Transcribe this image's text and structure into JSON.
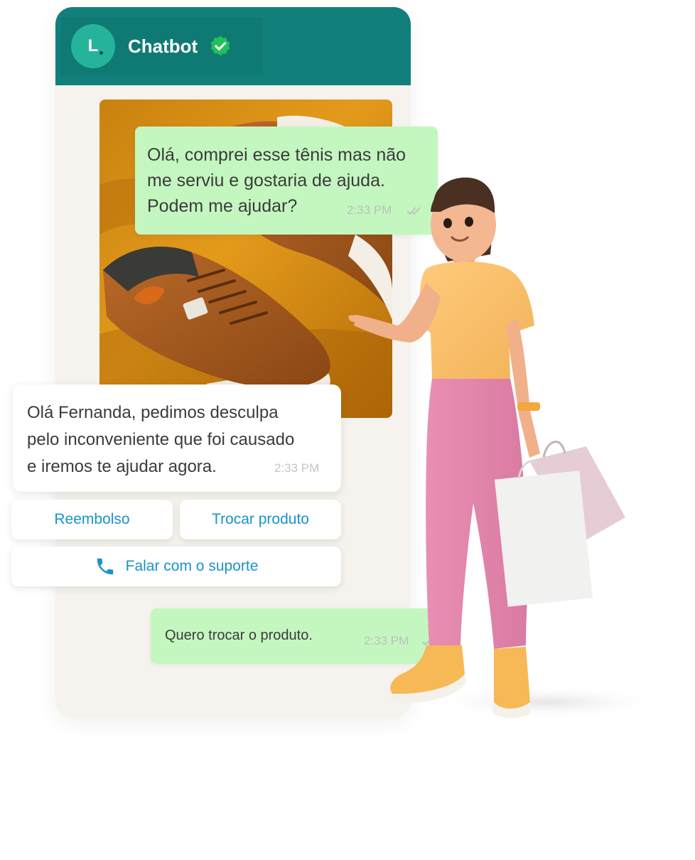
{
  "header": {
    "avatar_letter": "L",
    "title": "Chatbot",
    "verified_icon": "verified-check-icon"
  },
  "messages": {
    "customer_first": {
      "lines": [
        "Olá, comprei esse tênis mas não",
        "me serviu e gostaria de ajuda.",
        "Podem me ajudar?"
      ],
      "time": "2:33 PM"
    },
    "bot_reply": {
      "lines": [
        "Olá Fernanda, pedimos desculpa",
        "pelo inconveniente que foi causado",
        "e iremos te ajudar agora."
      ],
      "time": "2:33 PM"
    },
    "customer_second": {
      "text": "Quero trocar o produto.",
      "time": "2:33 PM"
    }
  },
  "quick_replies": {
    "refund": "Reembolso",
    "exchange": "Trocar produto",
    "support": "Falar com o suporte",
    "support_icon": "phone-icon"
  },
  "colors": {
    "header": "#11807a",
    "avatar": "#26b39c",
    "outgoing_bubble": "#c4f7c0",
    "link_blue": "#1a93c9"
  }
}
